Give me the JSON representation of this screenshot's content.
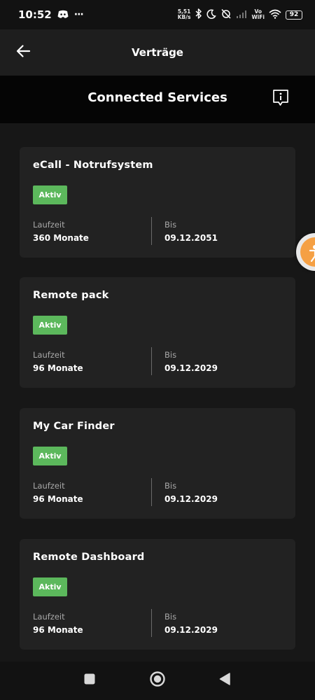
{
  "status_bar": {
    "time": "10:52",
    "more": "···",
    "speed_value": "5,51",
    "speed_unit": "KB/s",
    "vo_top": "Vo",
    "vo_bottom": "WiFi",
    "battery": "92"
  },
  "app_bar": {
    "title": "Verträge",
    "back_icon": "back-arrow-icon"
  },
  "section": {
    "title": "Connected Services",
    "info_icon": "info-icon"
  },
  "cards": [
    {
      "title": "eCall - Notrufsystem",
      "status": "Aktiv",
      "duration_label": "Laufzeit",
      "duration_value": "360 Monate",
      "until_label": "Bis",
      "until_value": "09.12.2051"
    },
    {
      "title": "Remote pack",
      "status": "Aktiv",
      "duration_label": "Laufzeit",
      "duration_value": "96 Monate",
      "until_label": "Bis",
      "until_value": "09.12.2029"
    },
    {
      "title": "My Car Finder",
      "status": "Aktiv",
      "duration_label": "Laufzeit",
      "duration_value": "96 Monate",
      "until_label": "Bis",
      "until_value": "09.12.2029"
    },
    {
      "title": "Remote Dashboard",
      "status": "Aktiv",
      "duration_label": "Laufzeit",
      "duration_value": "96 Monate",
      "until_label": "Bis",
      "until_value": "09.12.2029"
    }
  ],
  "colors": {
    "active_badge": "#5cb85c",
    "card_bg": "#222222",
    "header_bg": "#050505",
    "bubble": "#f5a044"
  },
  "nav_bar": {
    "recents_icon": "square-recents-icon",
    "home_icon": "circle-home-icon",
    "back_icon": "triangle-back-icon"
  }
}
